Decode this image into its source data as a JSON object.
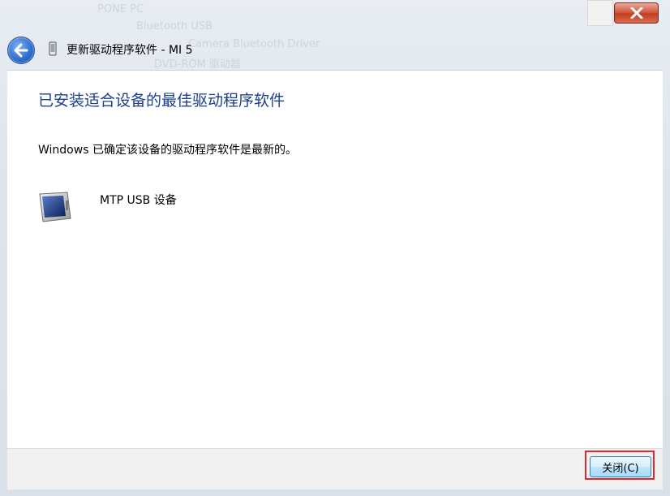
{
  "window": {
    "title": "更新驱动程序软件 - MI 5",
    "close_icon": "close-icon",
    "back_icon": "back-arrow-icon"
  },
  "background_ghost": {
    "items": [
      "PONE PC",
      "Bluetooth USB",
      "Camera Bluetooth Driver",
      "DVD-ROM 驱动器"
    ]
  },
  "content": {
    "heading": "已安装适合设备的最佳驱动程序软件",
    "description": "Windows 已确定该设备的驱动程序软件是最新的。",
    "device_icon": "portable-device-icon",
    "device_name": "MTP USB 设备"
  },
  "footer": {
    "close_button_label": "关闭(C)"
  },
  "colors": {
    "heading": "#1e3f8e",
    "highlight": "#e1282c",
    "button_border": "#3c7fb1"
  }
}
